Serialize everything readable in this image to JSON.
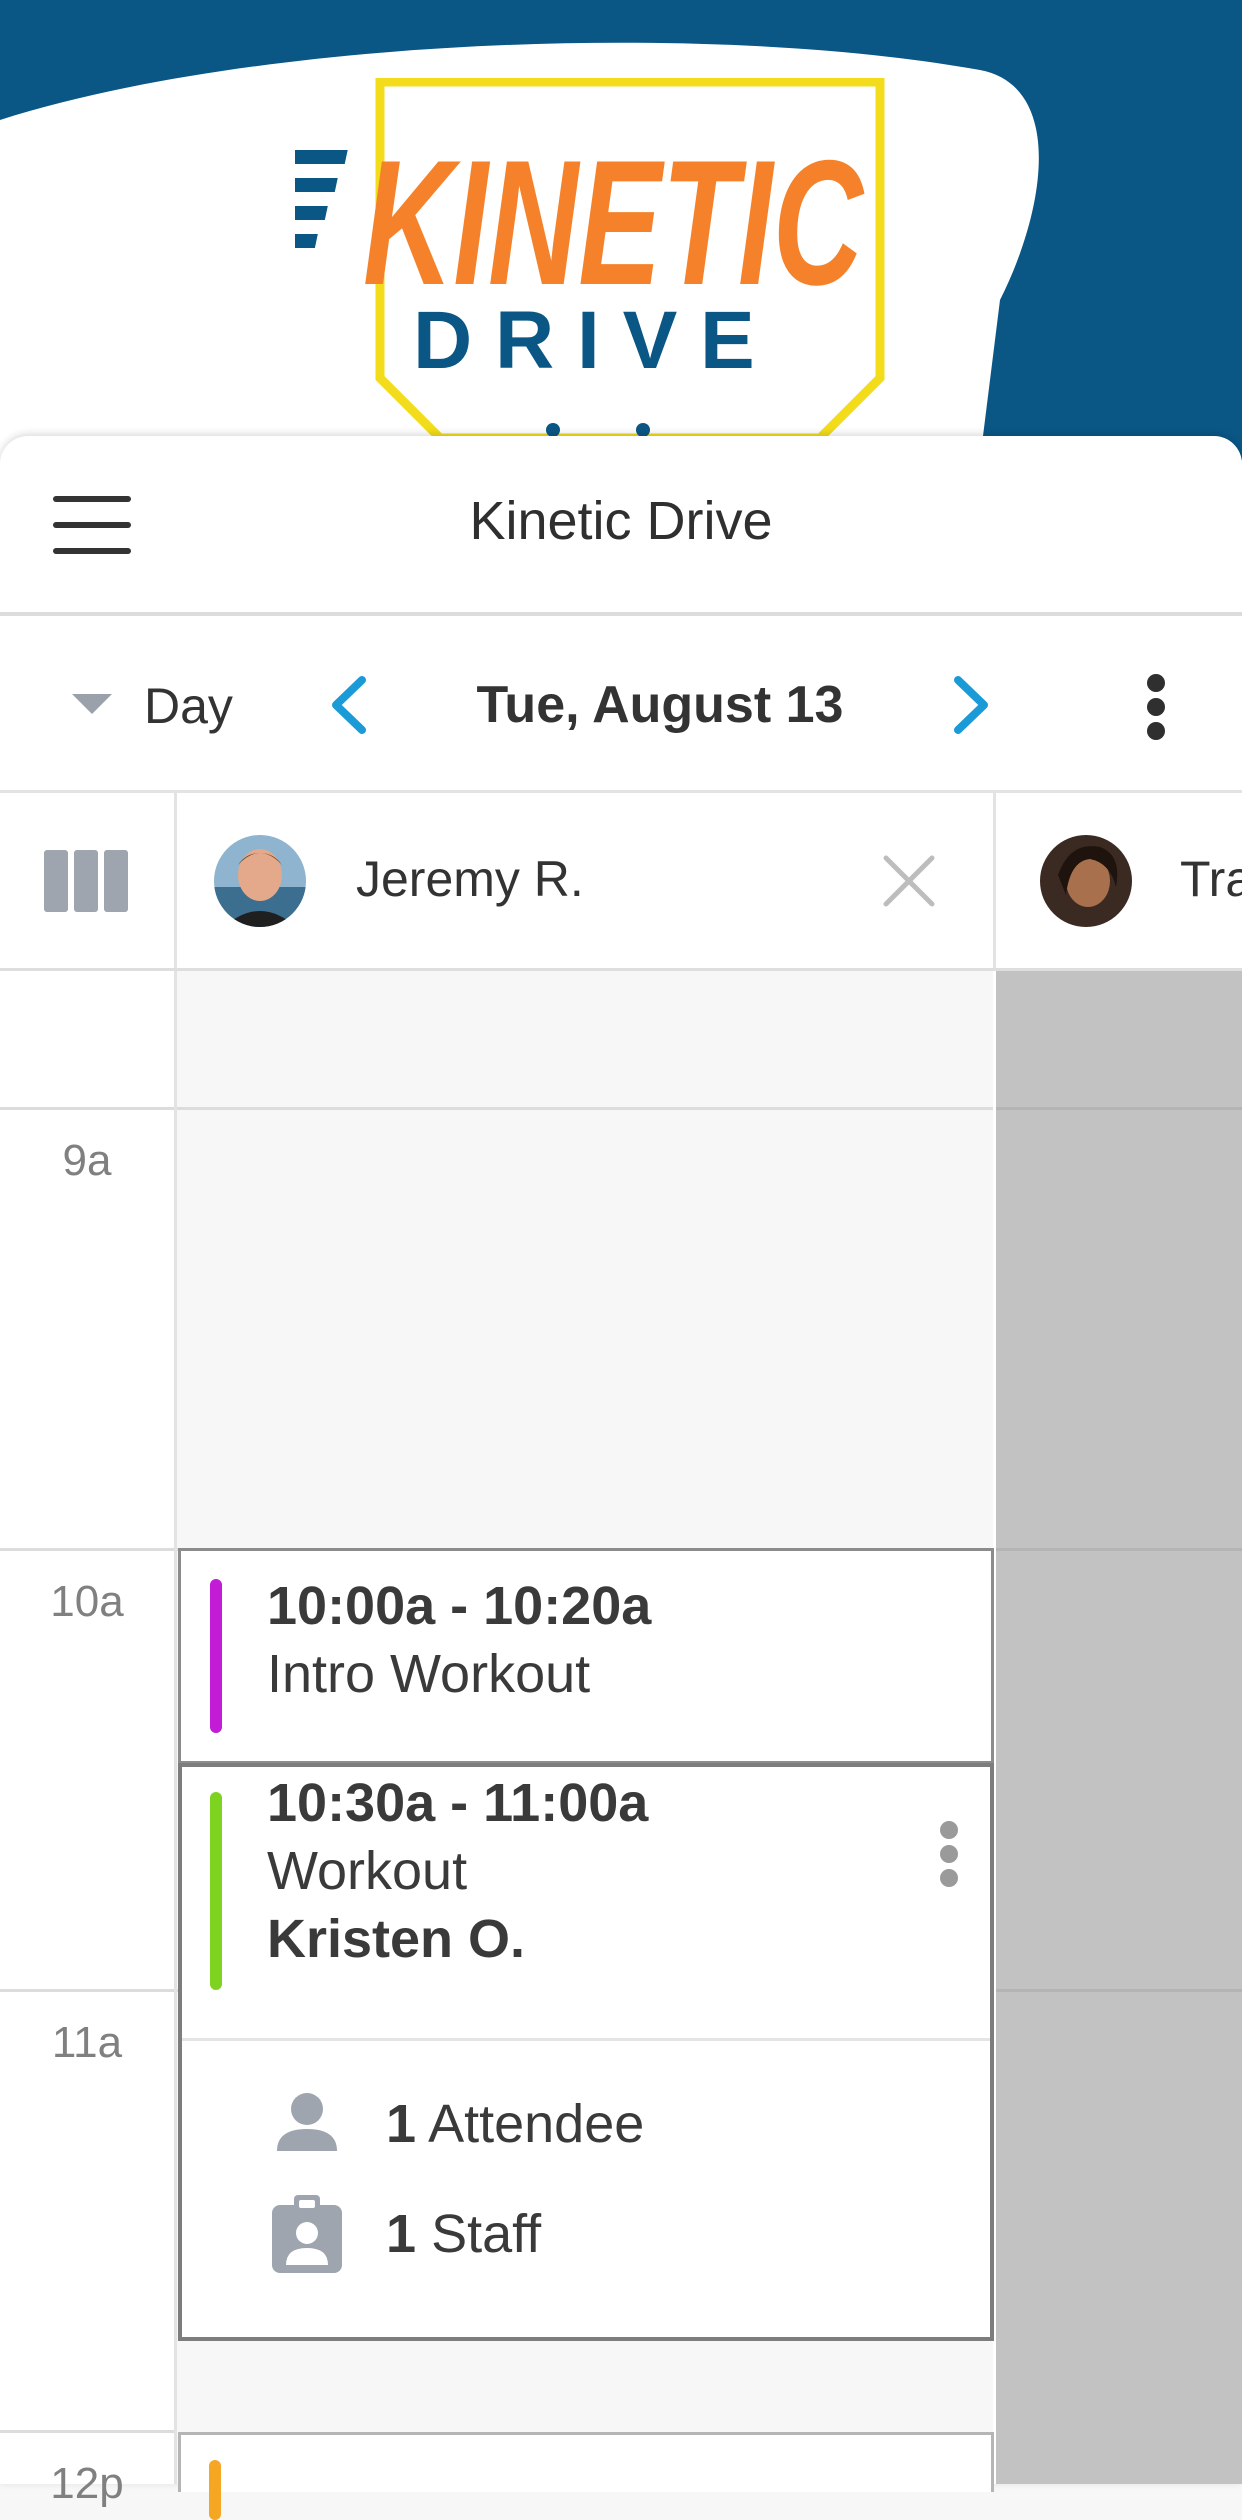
{
  "brand": {
    "logo_word": "KINETIC",
    "logo_subword": "D R I V E",
    "colors": {
      "navy": "#0a5786",
      "orange": "#f5822a",
      "yellow": "#f2dc1b"
    }
  },
  "appbar": {
    "title": "Kinetic Drive",
    "menu_icon": "hamburger-menu-icon"
  },
  "toolbar": {
    "view_label": "Day",
    "date_label": "Tue, August 13",
    "prev_icon": "chevron-left-icon",
    "next_icon": "chevron-right-icon",
    "more_icon": "vertical-dots-icon",
    "accent": "#1a9bd7"
  },
  "resources": [
    {
      "name": "Jeremy R."
    },
    {
      "name": "Tra"
    }
  ],
  "hours": [
    "9a",
    "10a",
    "11a",
    "12p"
  ],
  "events": [
    {
      "time": "10:00a - 10:20a",
      "title": "Intro Workout",
      "color": "#c21cd6"
    },
    {
      "time": "10:30a - 11:00a",
      "title": "Workout",
      "client": "Kristen O.",
      "color": "#7ed321",
      "attendees_count": "1",
      "attendees_label": "Attendee",
      "staff_count": "1",
      "staff_label": "Staff"
    },
    {
      "color": "#f5a623"
    }
  ]
}
